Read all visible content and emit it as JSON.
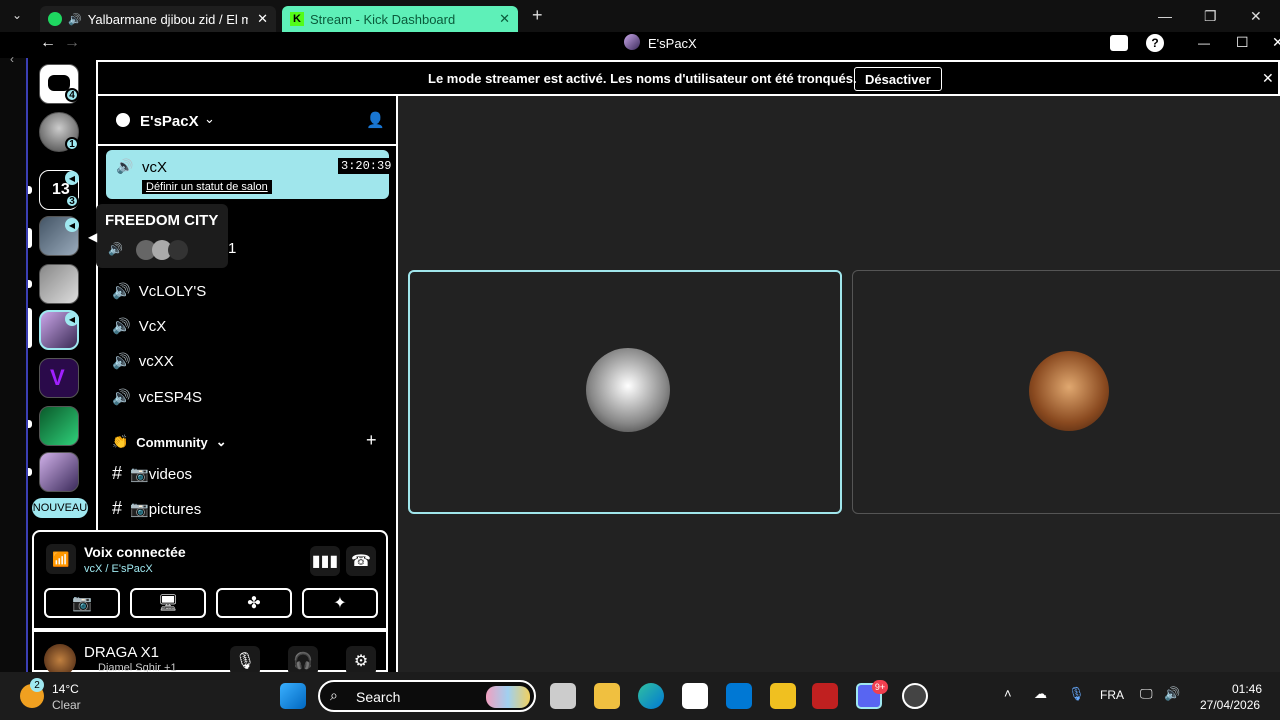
{
  "browser": {
    "tabs": [
      {
        "label": "Yalbarmane djibou zid / El me"
      },
      {
        "label": "Stream - Kick Dashboard"
      }
    ]
  },
  "app": {
    "title": "E'sPacX",
    "banner_text": "Le mode streamer est activé. Les noms d'utilisateur ont été tronqués.",
    "banner_button": "Désactiver"
  },
  "servers": [
    {
      "icon": "discord-home-icon",
      "badge": "4"
    },
    {
      "icon": "avatar",
      "badge": "1"
    },
    {
      "icon": "server",
      "badge": "3"
    },
    {
      "icon": "server",
      "badge": ""
    },
    {
      "icon": "server",
      "badge": ""
    },
    {
      "icon": "server",
      "badge": ""
    },
    {
      "icon": "server",
      "badge": ""
    },
    {
      "icon": "server",
      "badge": ""
    },
    {
      "icon": "server",
      "badge": ""
    }
  ],
  "new_label": "NOUVEAU",
  "tooltip": {
    "title": "FREEDOM CITY"
  },
  "channel_list": {
    "server_name": "E'sPacX",
    "active_channel": {
      "name": "vcX",
      "timer": "3:20:39",
      "status_link": "Définir un statut de salon"
    },
    "partial_channel": "1",
    "voice_channels": [
      "VcLOLY'S",
      "VcX",
      "vcXX",
      "vcESP4S"
    ],
    "category": "Community",
    "text_channels": [
      "📷videos",
      "📷pictures"
    ]
  },
  "voice_panel": {
    "status": "Voix connectée",
    "channel_path": "vcX / E'sPacX"
  },
  "user_panel": {
    "username": "DRAGA X1",
    "activity": "Djamel Sghir +1"
  },
  "taskbar": {
    "weather_temp": "14°C",
    "weather_desc": "Clear",
    "weather_badge": "2",
    "search_label": "Search",
    "lang": "FRA",
    "time": "01:46",
    "date": "27/04/2026",
    "discord_badge": "9+"
  },
  "colors": {
    "accent": "#a0e6ec",
    "kick_green": "#53fc18",
    "background": "#222222"
  }
}
